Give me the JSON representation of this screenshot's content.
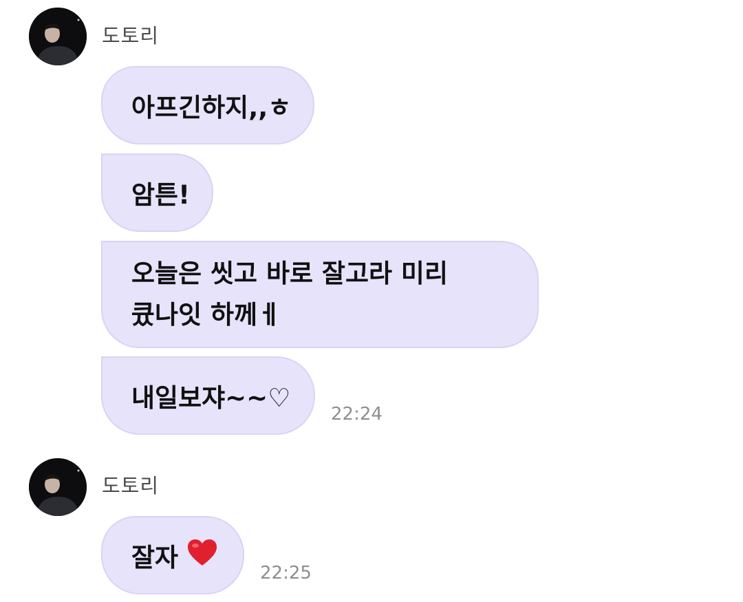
{
  "chat": {
    "groups": [
      {
        "sender": "도토리",
        "avatar_icon": "profile-photo",
        "messages": [
          {
            "lines": [
              "아프긴하지,,ㅎ"
            ]
          },
          {
            "lines": [
              "암튼!"
            ]
          },
          {
            "lines": [
              "오늘은 씻고 바로 잘고라 미리",
              "큤나잇 하께ㅔ"
            ]
          },
          {
            "lines": [
              "내일보쟈~~♡"
            ],
            "time": "22:24"
          }
        ]
      },
      {
        "sender": "도토리",
        "avatar_icon": "profile-photo",
        "messages": [
          {
            "lines": [
              "잘자"
            ],
            "emoji": "red-heart-icon",
            "time": "22:25"
          }
        ]
      }
    ]
  },
  "colors": {
    "bubble_bg": "#e6e3fb",
    "bubble_border": "#d8d4f3",
    "text": "#111111",
    "sender": "#4a4a4a",
    "time": "#8e8e8e",
    "heart": "#e0202e"
  }
}
